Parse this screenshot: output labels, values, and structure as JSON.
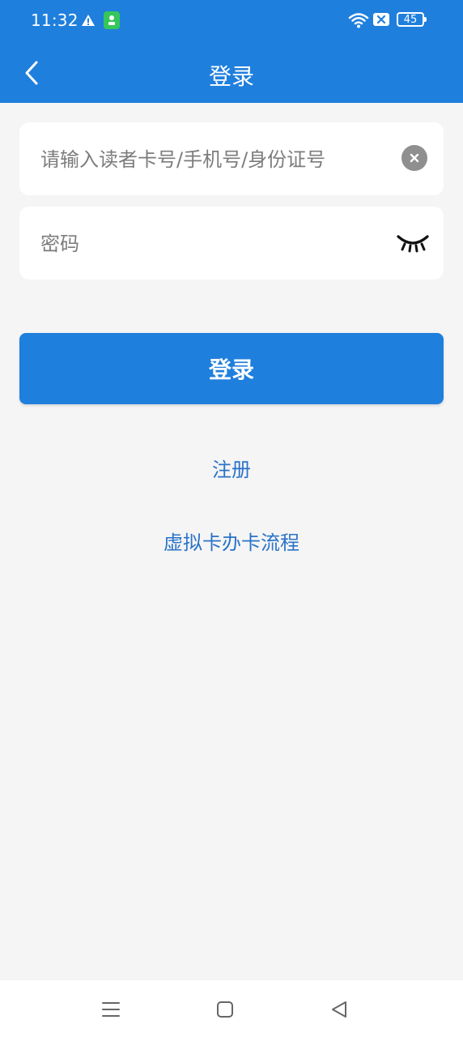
{
  "status_bar": {
    "time": "11:32",
    "battery": "45",
    "icons": {
      "warning": "warning-icon",
      "app": "app-icon",
      "wifi": "wifi-icon",
      "sim": "sim-icon",
      "battery": "battery-icon"
    }
  },
  "header": {
    "title": "登录",
    "back_icon": "back-icon"
  },
  "form": {
    "account": {
      "placeholder": "请输入读者卡号/手机号/身份证号",
      "value": ""
    },
    "password": {
      "placeholder": "密码",
      "value": ""
    },
    "login_label": "登录",
    "clear_icon": "clear-icon",
    "eye_icon": "eye-closed-icon"
  },
  "links": {
    "register": "注册",
    "virtual_card": "虚拟卡办卡流程"
  },
  "nav_bar": {
    "menu_icon": "menu-icon",
    "home_icon": "home-icon",
    "back_icon": "back-triangle-icon"
  },
  "colors": {
    "primary": "#1f7fdd",
    "link": "#2a73c8",
    "background": "#f5f5f5"
  }
}
